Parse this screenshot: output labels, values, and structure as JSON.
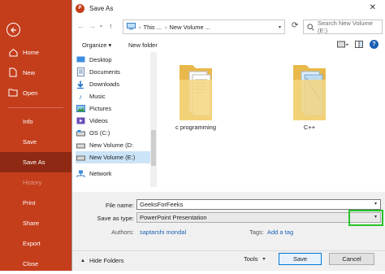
{
  "backstage": {
    "items": [
      {
        "label": "Home"
      },
      {
        "label": "New"
      },
      {
        "label": "Open"
      },
      {
        "label": "Info"
      },
      {
        "label": "Save"
      },
      {
        "label": "Save As"
      },
      {
        "label": "History"
      },
      {
        "label": "Print"
      },
      {
        "label": "Share"
      },
      {
        "label": "Export"
      },
      {
        "label": "Close"
      }
    ],
    "active": "Save As",
    "colors": {
      "panel": "#c43e1c",
      "active": "#8e2a14"
    }
  },
  "dialog": {
    "title": "Save As",
    "app_badge": "P",
    "address": {
      "segments": [
        "This ...",
        "New Volume ..."
      ],
      "separator": "›"
    },
    "search_placeholder": "Search New Volume (E:)",
    "toolbar": {
      "organize": "Organize ▾",
      "new_folder": "New folder"
    },
    "tree": [
      {
        "label": "Desktop",
        "icon": "desktop-icon"
      },
      {
        "label": "Documents",
        "icon": "documents-icon"
      },
      {
        "label": "Downloads",
        "icon": "downloads-icon"
      },
      {
        "label": "Music",
        "icon": "music-icon"
      },
      {
        "label": "Pictures",
        "icon": "pictures-icon"
      },
      {
        "label": "Videos",
        "icon": "videos-icon"
      },
      {
        "label": "OS (C:)",
        "icon": "drive-icon"
      },
      {
        "label": "New Volume (D:",
        "icon": "drive-icon"
      },
      {
        "label": "New Volume (E:)",
        "icon": "drive-icon",
        "selected": true
      },
      {
        "label": "Network",
        "icon": "network-icon"
      }
    ],
    "folders": [
      {
        "name": "c programming"
      },
      {
        "name": "C++"
      }
    ],
    "form": {
      "file_name_label": "File name:",
      "file_name_value": "GeeksForFeeks",
      "save_type_label": "Save as type:",
      "save_type_value": "PowerPoint Presentation",
      "authors_label": "Authors:",
      "authors_value": "saptarshi mondal",
      "tags_label": "Tags:",
      "tags_value": "Add a tag"
    },
    "footer": {
      "hide_folders": "Hide Folders",
      "tools": "Tools",
      "save": "Save",
      "cancel": "Cancel"
    },
    "highlight_color": "#27c429"
  }
}
